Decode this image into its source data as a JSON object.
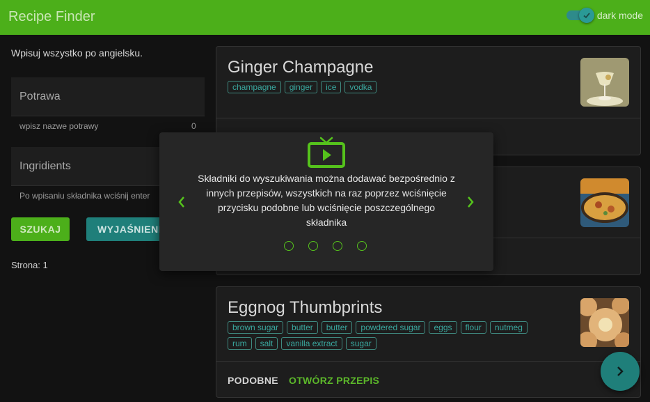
{
  "app": {
    "title": "Recipe Finder"
  },
  "dark_mode": {
    "label": "dark mode",
    "enabled": true
  },
  "search": {
    "hint": "Wpisuj wszystko po angielsku.",
    "dish_label": "Potrawa",
    "dish_helper": "wpisz nazwe potrawy",
    "dish_count": "0",
    "ingredients_label": "Ingridients",
    "ingredients_helper": "Po wpisaniu składnika wciśnij enter",
    "search_button": "SZUKAJ",
    "explain_button": "WYJAŚNIENIE",
    "page_label": "Strona: 1"
  },
  "recipes": [
    {
      "title": "Ginger Champagne",
      "tags": [
        "champagne",
        "ginger",
        "ice",
        "vodka"
      ]
    },
    {
      "title": "",
      "tags": []
    },
    {
      "title": "Eggnog Thumbprints",
      "tags": [
        "brown sugar",
        "butter",
        "butter",
        "powdered sugar",
        "eggs",
        "flour",
        "nutmeg",
        "rum",
        "salt",
        "vanilla extract",
        "sugar"
      ],
      "similar_label": "PODOBNE",
      "open_label": "OTWÓRZ PRZEPIS"
    }
  ],
  "tutorial": {
    "text": "Składniki do wyszukiwania można dodawać bezpośrednio z innych przepisów, wszystkich na raz poprzez wciśnięcie przycisku podobne lub wciśnięcie poszczególnego składnika",
    "step_count": 4,
    "icon": "tv-play-icon"
  },
  "colors": {
    "primary": "#4caf1a",
    "secondary": "#1f7f7a",
    "background": "#121212",
    "accent_green": "#55c21c"
  }
}
